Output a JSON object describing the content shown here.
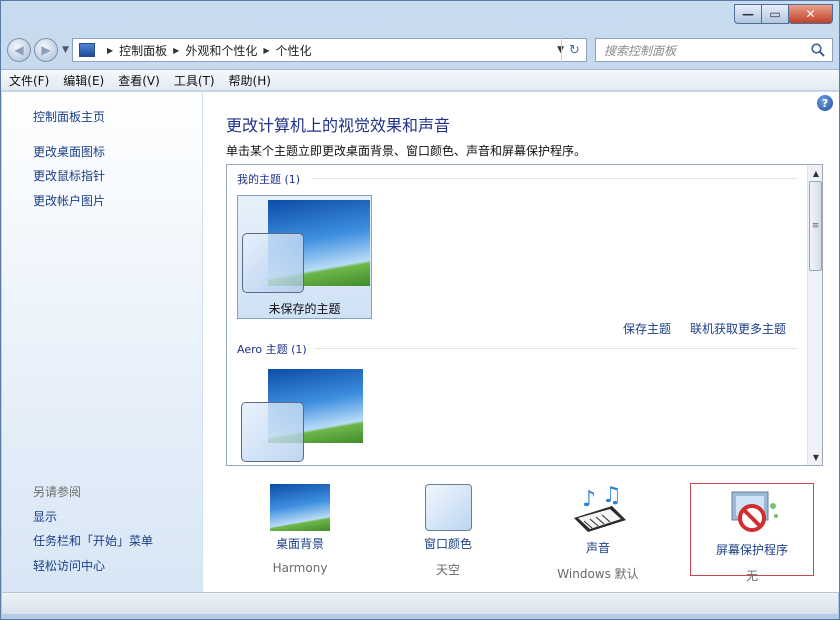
{
  "window": {
    "minimize_glyph": "—",
    "maximize_glyph": "▭",
    "close_glyph": "✕"
  },
  "address": {
    "crumbs": [
      "控制面板",
      "外观和个性化",
      "个性化"
    ],
    "search_placeholder": "搜索控制面板"
  },
  "menu": [
    "文件(F)",
    "编辑(E)",
    "查看(V)",
    "工具(T)",
    "帮助(H)"
  ],
  "sidebar": {
    "home": "控制面板主页",
    "links": [
      "更改桌面图标",
      "更改鼠标指针",
      "更改帐户图片"
    ],
    "see_also": "另请参阅",
    "see_also_links": [
      "显示",
      "任务栏和「开始」菜单",
      "轻松访问中心"
    ]
  },
  "main": {
    "help_glyph": "?",
    "heading": "更改计算机上的视觉效果和声音",
    "description": "单击某个主题立即更改桌面背景、窗口颜色、声音和屏幕保护程序。",
    "my_themes_label": "我的主题 (1)",
    "unsaved_theme": "未保存的主题",
    "save_theme": "保存主题",
    "get_more_themes": "联机获取更多主题",
    "aero_label": "Aero 主题 (1)"
  },
  "bottom": [
    {
      "label": "桌面背景",
      "value": "Harmony"
    },
    {
      "label": "窗口颜色",
      "value": "天空"
    },
    {
      "label": "声音",
      "value": "Windows 默认"
    },
    {
      "label": "屏幕保护程序",
      "value": "无"
    }
  ],
  "icons": [
    "back-icon",
    "forward-icon",
    "control-panel-icon",
    "refresh-icon",
    "search-icon",
    "help-icon",
    "sound-icon",
    "screensaver-icon"
  ]
}
